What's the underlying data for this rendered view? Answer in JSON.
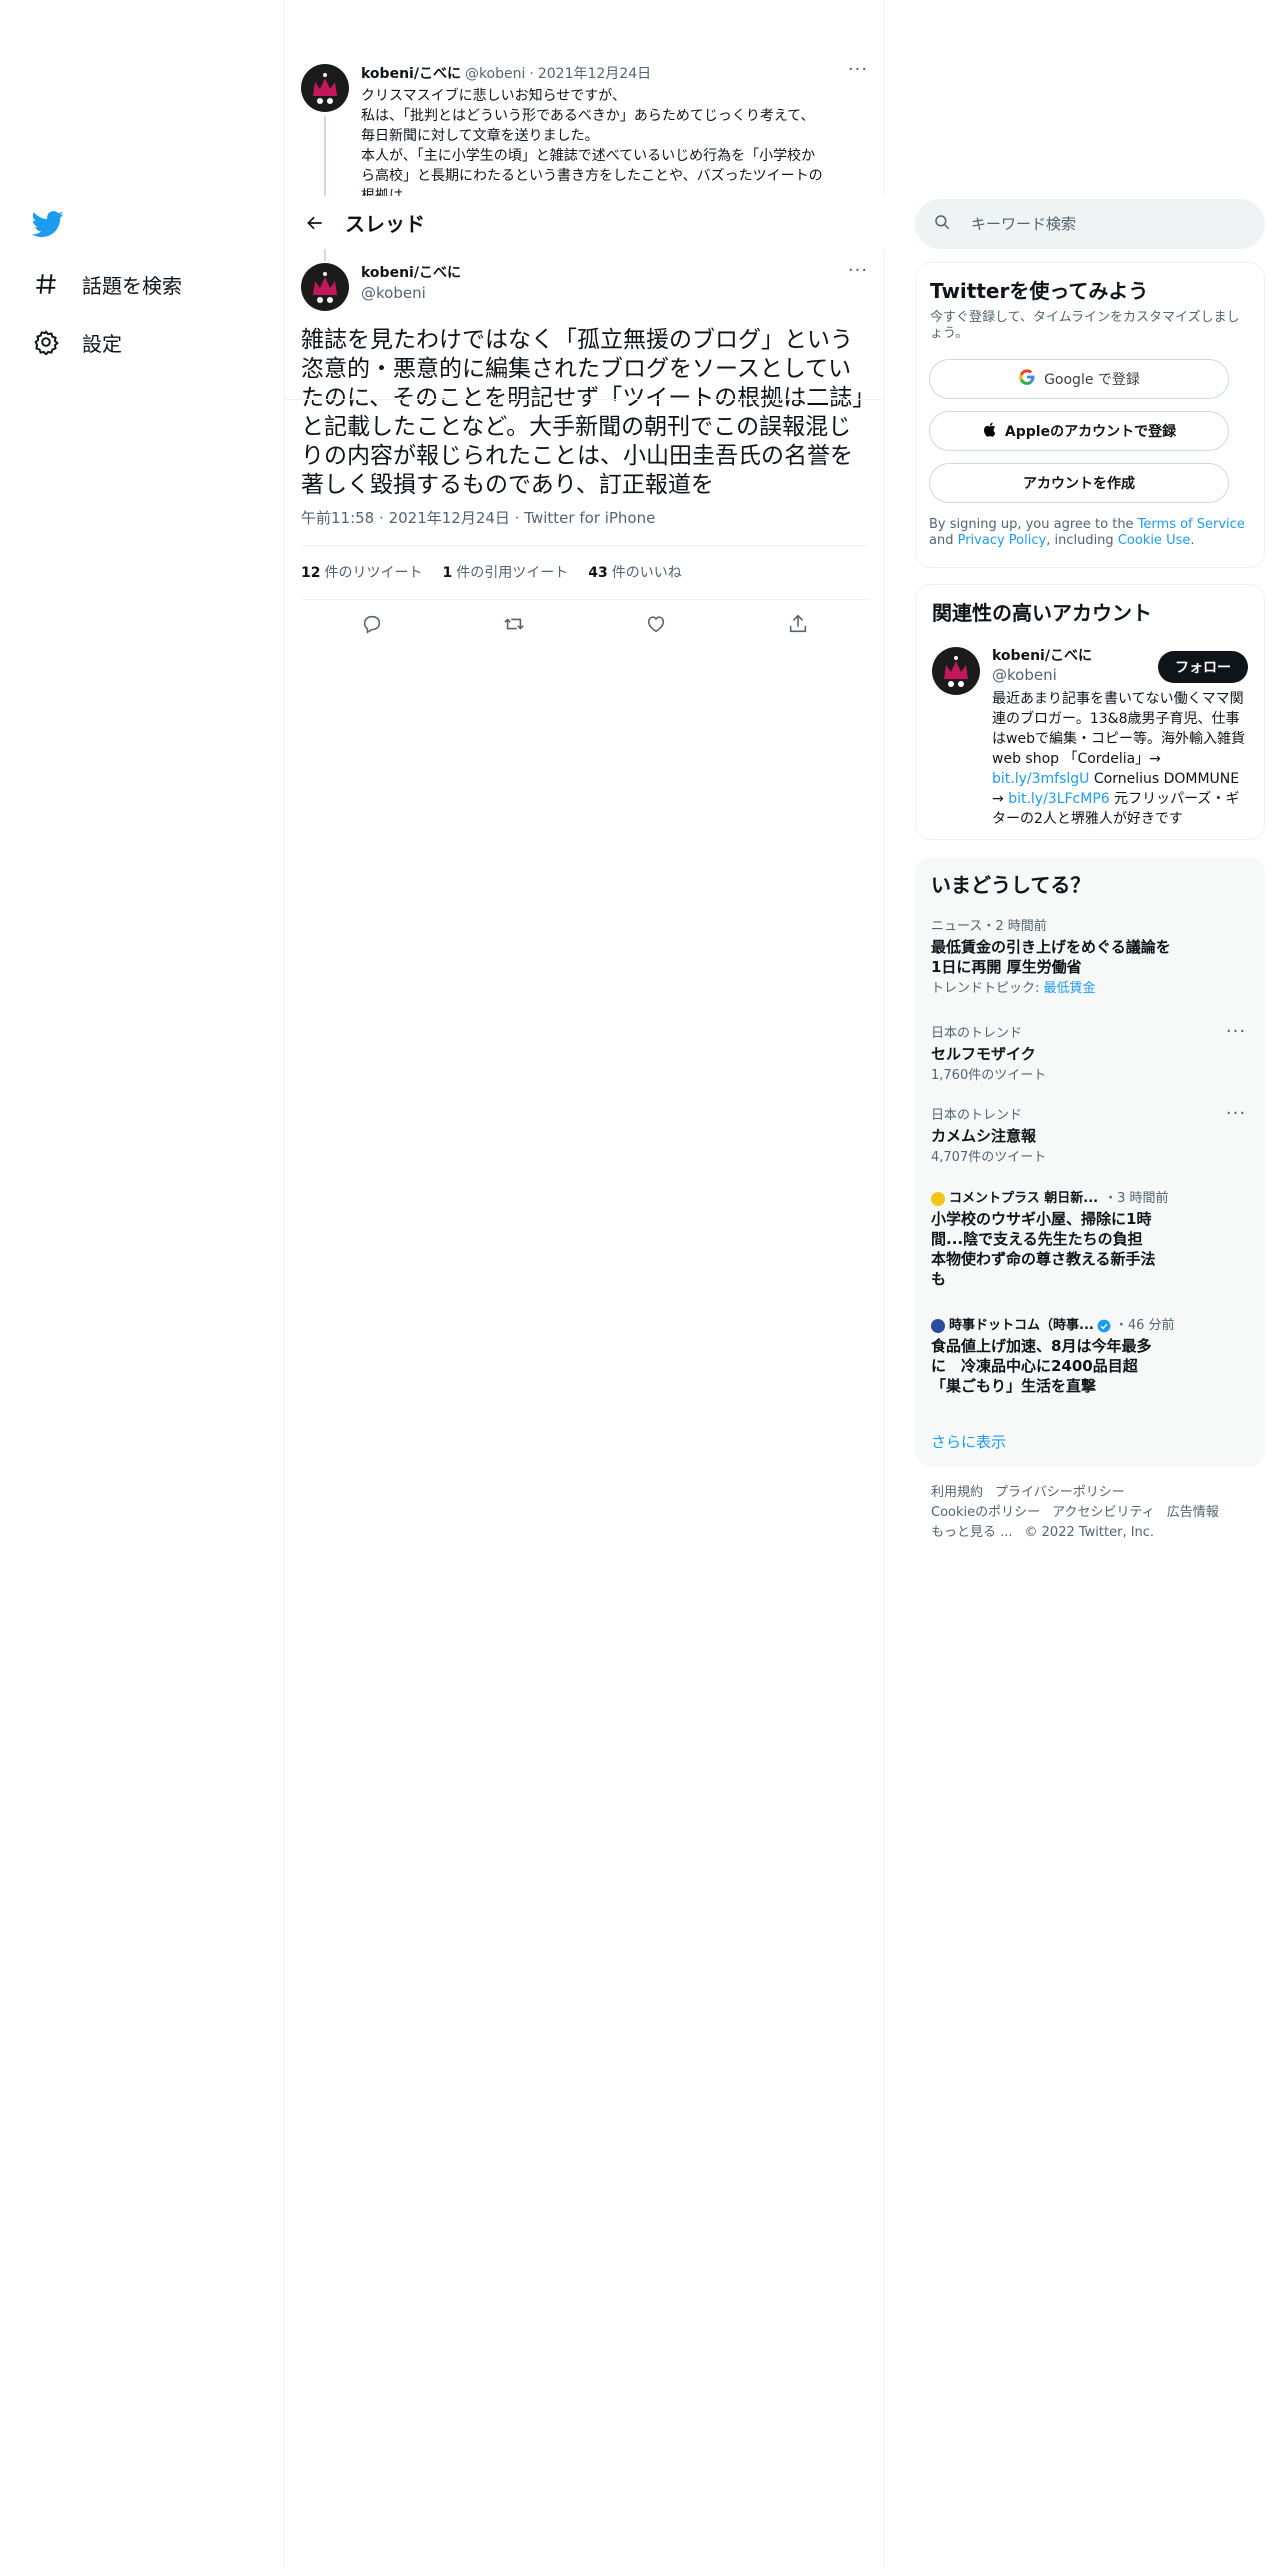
{
  "nav": {
    "explore_label": "話題を検索",
    "settings_label": "設定"
  },
  "prev_tweet": {
    "name": "kobeni/こべに",
    "handle": "@kobeni",
    "separator": "·",
    "date": "2021年12月24日",
    "more": "···",
    "lines": [
      "クリスマスイブに悲しいお知らせですが、",
      "私は、「批判とはどういう形であるべきか」あらためてじっくり考えて、",
      "毎日新聞に対して文章を送りました。",
      "本人が、「主に小学生の頃」と雑誌で述べているいじめ行為を「小学校か",
      "ら高校」と長期にわたるという書き方をしたことや、バズったツイートの",
      "根拠は"
    ]
  },
  "header": {
    "title": "スレッド"
  },
  "focus_tweet": {
    "name": "kobeni/こべに",
    "handle": "@kobeni",
    "more": "···",
    "text": "雑誌を見たわけではなく「孤立無援のブログ」という恣意的・悪意的に編集されたブログをソースとしていたのに、そのことを明記せず「ツイートの根拠は二誌」と記載したことなど。大手新聞の朝刊でこの誤報混じりの内容が報じられたことは、小山田圭吾氏の名誉を著しく毀損するものであり、訂正報道を",
    "time": "午前11:58",
    "date": "2021年12月24日",
    "source": "Twitter for iPhone",
    "separator": "·",
    "stats": {
      "retweets": {
        "num": "12",
        "label": "件のリツイート"
      },
      "quotes": {
        "num": "1",
        "label": "件の引用ツイート"
      },
      "likes": {
        "num": "43",
        "label": "件のいいね"
      }
    }
  },
  "search": {
    "placeholder": "キーワード検索"
  },
  "signup": {
    "title": "Twitterを使ってみよう",
    "subtitle": "今すぐ登録して、タイムラインをカスタマイズしましょう。",
    "google_label": "Google で登録",
    "apple_label": "Appleのアカウントで登録",
    "create_label": "アカウントを作成",
    "legal_prefix": "By signing up, you agree to the ",
    "terms": "Terms of Service",
    "legal_and": " and ",
    "privacy": "Privacy Policy",
    "legal_including": ", including ",
    "cookie": "Cookie Use",
    "legal_end": "."
  },
  "related": {
    "title": "関連性の高いアカウント",
    "name": "kobeni/こべに",
    "handle": "@kobeni",
    "follow_label": "フォロー",
    "bio_text": "最近あまり記事を書いてない働くママ関連のブロガー。13&8歳男子育児、仕事はwebで編集・コピー等。海外輸入雑貨web shop 「Cordelia」→ ",
    "bio_link1": "bit.ly/3mfslgU",
    "bio_mid": " Cornelius DOMMUNE → ",
    "bio_link2": "bit.ly/3LFcMP6",
    "bio_end": " 元フリッパーズ・ギターの2人と堺雅人が好きです"
  },
  "trends": {
    "title": "いまどうしてる？",
    "items": [
      {
        "meta": "ニュース・2 時間前",
        "title": "最低賃金の引き上げをめぐる議論を1日に再開 厚生労働省",
        "sub_prefix": "トレンドトピック: ",
        "sub_link": "最低賃金"
      },
      {
        "meta": "日本のトレンド",
        "title": "セルフモザイク",
        "sub": "1,760件のツイート",
        "more": "···"
      },
      {
        "meta": "日本のトレンド",
        "title": "カメムシ注意報",
        "sub": "4,707件のツイート",
        "more": "···"
      },
      {
        "source": "コメントプラス 朝日新...",
        "time": "・3 時間前",
        "title": "小学校のウサギ小屋、掃除に1時間...陰で支える先生たちの負担　本物使わず命の尊さ教える新手法も"
      },
      {
        "source": "時事ドットコム（時事...",
        "time": "・46 分前",
        "title": "食品値上げ加速、8月は今年最多に　冷凍品中心に2400品目超　「巣ごもり」生活を直撃"
      }
    ],
    "show_more": "さらに表示"
  },
  "footer": {
    "terms": "利用規約",
    "privacy": "プライバシーポリシー",
    "cookie": "Cookieのポリシー",
    "accessibility": "アクセシビリティ",
    "ads": "広告情報",
    "more": "もっと見る ...",
    "copyright": "© 2022 Twitter, Inc."
  },
  "colors": {
    "accent": "#1d9bf0",
    "text": "#0f1419",
    "secondary": "#536471",
    "border": "#eff3f4"
  },
  "icons": [
    "twitter-logo-icon",
    "hashtag-icon",
    "gear-icon",
    "back-arrow-icon",
    "reply-icon",
    "retweet-icon",
    "like-icon",
    "share-icon",
    "search-icon",
    "google-icon",
    "apple-icon",
    "verified-icon"
  ]
}
